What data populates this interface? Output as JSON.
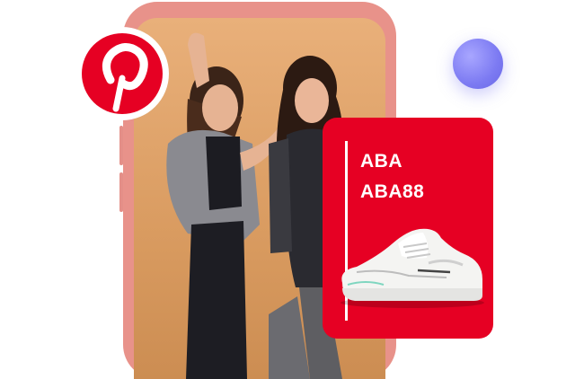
{
  "brand": {
    "logo_icon": "pinterest-logo-icon",
    "logo_color": "#e60023"
  },
  "product": {
    "line1": "ABA",
    "line2": "ABA88",
    "card_color": "#e60023",
    "image_icon": "sneaker-icon"
  },
  "colors": {
    "phone_frame": "#e8928a",
    "screen_bg": "#e9b07a",
    "accent_orb": "#7c7af2"
  }
}
